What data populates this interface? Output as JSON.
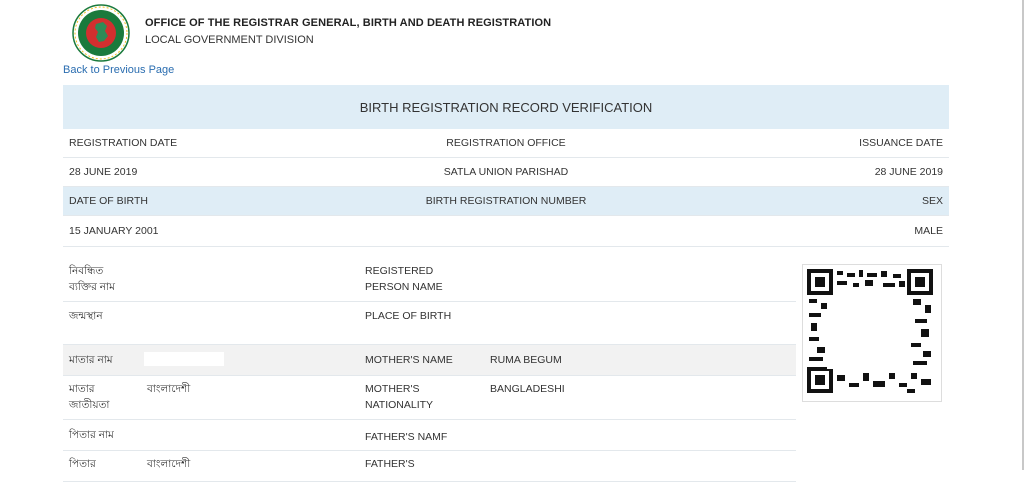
{
  "header": {
    "title": "OFFICE OF THE REGISTRAR GENERAL, BIRTH AND DEATH REGISTRATION",
    "subtitle": "LOCAL GOVERNMENT DIVISION",
    "logo_icon": "bangladesh-seal-icon"
  },
  "back_link": "Back to Previous Page",
  "record": {
    "heading": "BIRTH REGISTRATION RECORD VERIFICATION",
    "labels_row1": {
      "registration_date": "REGISTRATION DATE",
      "registration_office": "REGISTRATION OFFICE",
      "issuance_date": "ISSUANCE DATE"
    },
    "values_row1": {
      "registration_date": "28 JUNE 2019",
      "registration_office": "SATLA UNION PARISHAD",
      "issuance_date": "28 JUNE 2019"
    },
    "labels_row2": {
      "date_of_birth": "DATE OF BIRTH",
      "birth_registration_number": "BIRTH REGISTRATION NUMBER",
      "sex": "SEX"
    },
    "values_row2": {
      "date_of_birth": "15 JANUARY 2001",
      "sex": "MALE"
    }
  },
  "person": {
    "registered_name": {
      "bn_label_line1": "নিবন্ধিত",
      "bn_label_line2": "ব্যক্তির নাম",
      "en_label_line1": "REGISTERED",
      "en_label_line2": "PERSON NAME"
    },
    "place_of_birth": {
      "bn_label": "জন্মস্থান",
      "en_label": "PLACE OF BIRTH"
    },
    "mother_name": {
      "bn_label": "মাতার নাম",
      "en_label": "MOTHER'S NAME",
      "en_value": "RUMA BEGUM"
    },
    "mother_nationality": {
      "bn_label_line1": "মাতার",
      "bn_label_line2": "জাতীয়তা",
      "bn_value": "বাংলাদেশী",
      "en_label_line1": "MOTHER'S",
      "en_label_line2": "NATIONALITY",
      "en_value": "BANGLADESHI"
    },
    "father_name": {
      "bn_label": "পিতার নাম",
      "en_label": "FATHER'S NAMF"
    },
    "father_nationality": {
      "bn_label_line1": "পিতার",
      "bn_value": "বাংলাদেশী",
      "en_label_line1": "FATHER'S"
    }
  },
  "qr": {
    "icon": "qr-code-icon"
  },
  "colors": {
    "accent_bg": "#dfedf6",
    "link": "#2a6db0",
    "seal_green": "#1a7a3c",
    "seal_red": "#d32f2f"
  }
}
